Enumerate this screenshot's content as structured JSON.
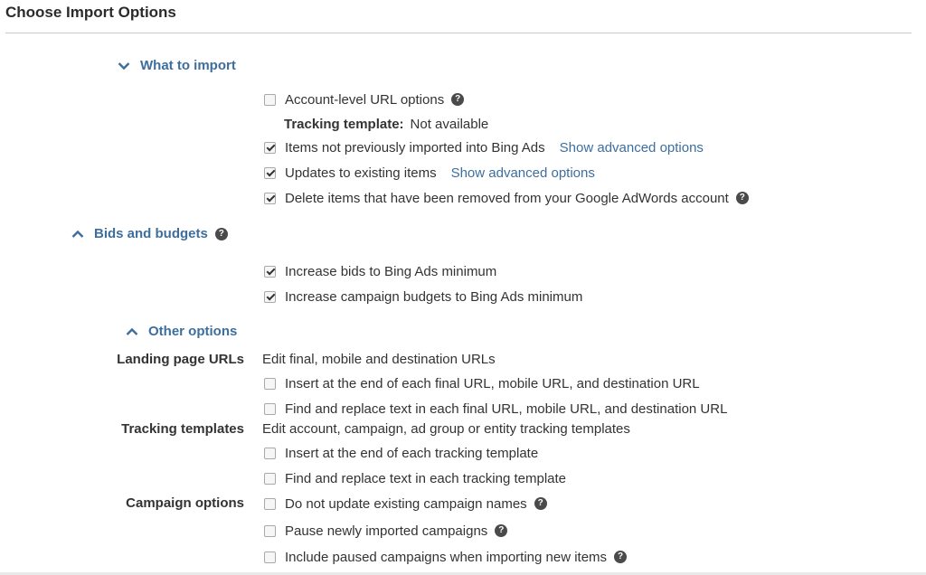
{
  "page": {
    "title": "Choose Import Options"
  },
  "what_to_import": {
    "header": "What to import",
    "items": [
      {
        "label": "Account-level URL options",
        "checked": false,
        "help": true
      },
      {
        "label": "Items not previously imported into Bing Ads",
        "checked": true,
        "link": "Show advanced options"
      },
      {
        "label": "Updates to existing items",
        "checked": true,
        "link": "Show advanced options"
      },
      {
        "label": "Delete items that have been removed from your Google AdWords account",
        "checked": true,
        "help": true
      }
    ],
    "tracking_template_label": "Tracking template:",
    "tracking_template_value": "Not available"
  },
  "bids_and_budgets": {
    "header": "Bids and budgets",
    "items": [
      {
        "label": "Increase bids to Bing Ads minimum",
        "checked": true
      },
      {
        "label": "Increase campaign budgets to Bing Ads minimum",
        "checked": true
      }
    ]
  },
  "other_options": {
    "header": "Other options",
    "landing_page_urls": {
      "label": "Landing page URLs",
      "description": "Edit final, mobile and destination URLs",
      "items": [
        {
          "label": "Insert at the end of each final URL, mobile URL, and destination URL",
          "checked": false
        },
        {
          "label": "Find and replace text in each final URL, mobile URL, and destination URL",
          "checked": false
        }
      ]
    },
    "tracking_templates": {
      "label": "Tracking templates",
      "description": "Edit account, campaign, ad group or entity tracking templates",
      "items": [
        {
          "label": "Insert at the end of each tracking template",
          "checked": false
        },
        {
          "label": "Find and replace text in each tracking template",
          "checked": false
        }
      ]
    },
    "campaign_options": {
      "label": "Campaign options",
      "items": [
        {
          "label": "Do not update existing campaign names",
          "checked": false,
          "help": true
        },
        {
          "label": "Pause newly imported campaigns",
          "checked": false,
          "help": true
        },
        {
          "label": "Include paused campaigns when importing new items",
          "checked": false,
          "help": true
        }
      ]
    }
  },
  "icons": {
    "help": "?"
  }
}
